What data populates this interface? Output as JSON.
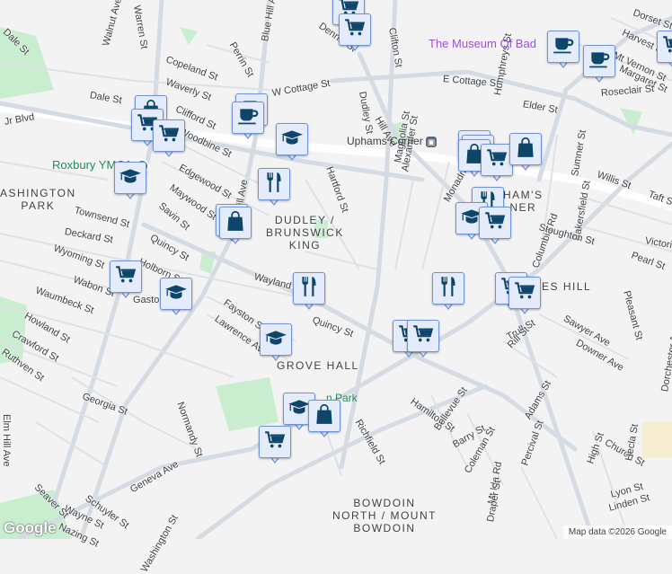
{
  "map": {
    "neighborhoods": [
      "WASHINGTON PARK",
      "DUDLEY / BRUNSWICK KING",
      "GROVE HALL",
      "BOWDOIN NORTH / MOUNT BOWDOIN",
      "UPHAMS CORNER",
      "MEETING HOUSE HILL"
    ],
    "hood_lines": {
      "wp1": "ASHINGTON",
      "wp2": "PARK",
      "dbk1": "DUDLEY /",
      "dbk2": "BRUNSWICK",
      "dbk3": "KING",
      "gh": "GROVE HALL",
      "bn1": "BOWDOIN",
      "bn2": "NORTH / MOUNT",
      "bn3": "BOWDOIN",
      "uc1": "HAM'S",
      "uc2": "NER",
      "mhh": "ES HILL"
    },
    "pois": {
      "ymca": "Roxbury YMCA",
      "museum": "The Museum Of Bad",
      "uphams": "Uphams Corner",
      "park": "n Park"
    },
    "streets": [
      "Dale St",
      "Walnut Ave",
      "Warren St",
      "Copeland St",
      "Perrin St",
      "Blue Hill Ave",
      "Dennis St",
      "Clifton St",
      "W Cottage St",
      "Waverly St",
      "Dale St",
      "Clifford St",
      "Woodbine St",
      "Edgewood St",
      "Maywood St",
      "Savin St",
      "Townsend St",
      "Deckard St",
      "Quincy St",
      "Wyoming St",
      "Holborn St",
      "Wabon St",
      "Waumbeck St",
      "Gaston St",
      "Howland St",
      "Crawford St",
      "Ruthven St",
      "Fayston St",
      "Lawrence Ave",
      "Wayland St",
      "Hartford St",
      "Dudley St",
      "Magnolia St",
      "Alexander St",
      "Monadnock St",
      "E Cottage St",
      "Elder St",
      "Humphreys St",
      "Columbia Rd",
      "Sumner St",
      "Willis St",
      "Taft St",
      "Bakersfield St",
      "Victoria St",
      "Pearl St",
      "Pleasant St",
      "Stoughton St",
      "Quincy St",
      "Trull St",
      "Rill St",
      "Sawyer Ave",
      "Downer Ave",
      "Hamilton St",
      "Bellevue St",
      "Barry St",
      "Richfield St",
      "Georgia St",
      "Normandy St",
      "Schuyler St",
      "Geneva Ave",
      "Washington St",
      "Elm Hill Ave",
      "Wayne St",
      "Nazing St",
      "Seaver St",
      "Adams St",
      "Coleman St",
      "Percival St",
      "Mt Ida Rd",
      "Draper St",
      "High St",
      "Church St",
      "Hecla St",
      "Lyon St",
      "Linden St",
      "Dorchester Ave",
      "Dorset St",
      "Harvest St",
      "Mt Vernon St",
      "Margaret St",
      "Roseclair St",
      "Jr Blvd",
      "Hill Ave",
      "Hill Ave",
      "Dudley St",
      "Jr Blvd"
    ],
    "attribution": "Map data ©2026 Google",
    "logo": "Google"
  },
  "markers": [
    "cart",
    "cart",
    "bag",
    "cart",
    "cart",
    "coffee",
    "coffee",
    "grad",
    "grad",
    "fork",
    "bag",
    "bag",
    "cart",
    "grad",
    "fork",
    "grad",
    "cart",
    "cart",
    "grad",
    "bag",
    "cart",
    "coffee",
    "coffee",
    "bag",
    "bag",
    "bag",
    "cart",
    "bag",
    "fork",
    "grad",
    "cart",
    "fork",
    "cart",
    "cart",
    "cart"
  ],
  "colors": {
    "marker_bg": "#e4ecfb",
    "marker_border": "#6f93d8",
    "icon": "#0d4668",
    "park": "#c6ecd2",
    "road": "#d5dbe2",
    "poi_green": "#1e8e5a",
    "poi_purple": "#9a4fe0"
  }
}
